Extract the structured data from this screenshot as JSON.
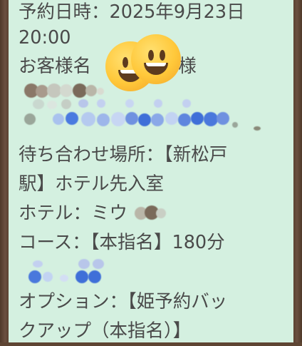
{
  "reservation": {
    "datetime_line1": "予約日時：2025年9月23日",
    "datetime_line2": "20:00",
    "customer_prefix": "お客様名",
    "customer_suffix": "様",
    "meeting_place_line1": "待ち合わせ場所：【新松戸",
    "meeting_place_line2": "駅】ホテル先入室",
    "hotel_label": "ホテル：ミウ",
    "course": "コース：【本指名】180分",
    "option_line1": "オプション：【姫予約バッ",
    "option_line2": "クアップ（本指名）】"
  },
  "emoji": {
    "name": "grinning-face-emoji"
  },
  "colors": {
    "bubble_bg": "#d4f0e0",
    "frame": "#5e4533",
    "text": "#4a4a4a",
    "redact_blue": "#3f6fd8",
    "redact_brown": "#7a6a5a"
  }
}
